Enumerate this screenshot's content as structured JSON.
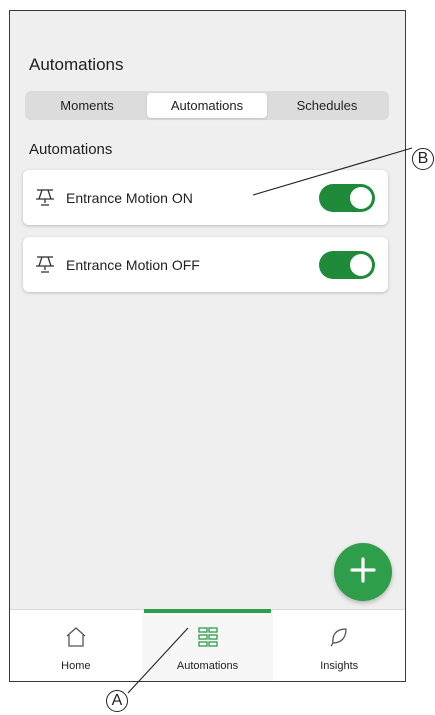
{
  "header": {
    "title": "Automations"
  },
  "tabs": [
    {
      "label": "Moments",
      "active": false
    },
    {
      "label": "Automations",
      "active": true
    },
    {
      "label": "Schedules",
      "active": false
    }
  ],
  "section": {
    "title": "Automations"
  },
  "automations": [
    {
      "label": "Entrance Motion ON",
      "enabled": true,
      "icon": "motion-sensor-icon"
    },
    {
      "label": "Entrance Motion OFF",
      "enabled": true,
      "icon": "motion-sensor-icon"
    }
  ],
  "fab": {
    "icon": "plus-icon"
  },
  "bottom_nav": [
    {
      "label": "Home",
      "icon": "home-icon",
      "active": false
    },
    {
      "label": "Automations",
      "icon": "automations-grid-icon",
      "active": true
    },
    {
      "label": "Insights",
      "icon": "leaf-icon",
      "active": false
    }
  ],
  "callouts": {
    "a": "A",
    "b": "B"
  },
  "colors": {
    "accent": "#2e9e4a",
    "toggle_on": "#1f8a3a",
    "background": "#efefef"
  }
}
